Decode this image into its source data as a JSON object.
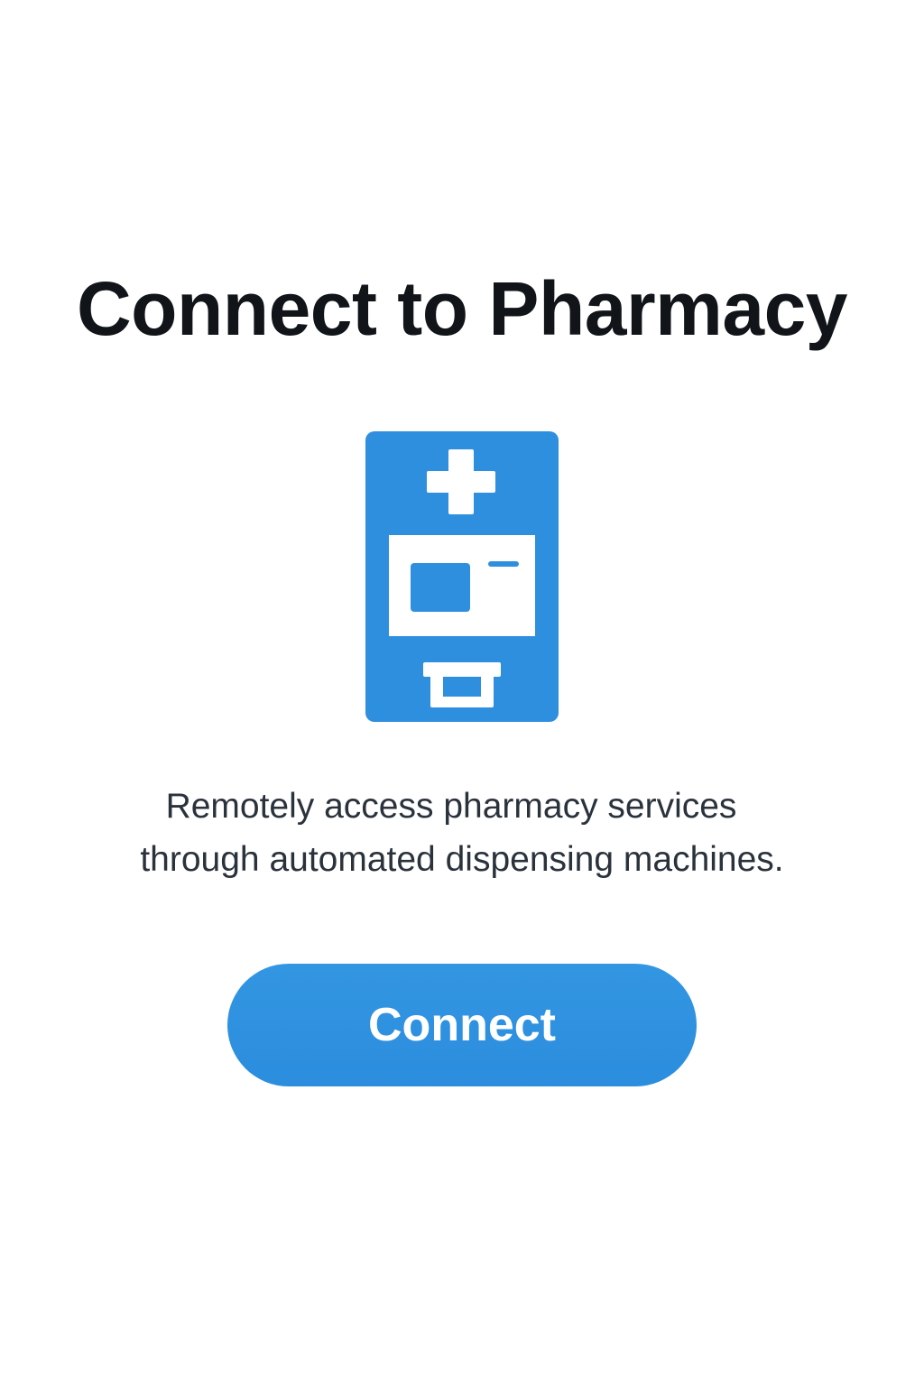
{
  "header": {
    "title": "Connect to Pharmacy"
  },
  "illustration": {
    "icon": "pharmacy-kiosk-icon",
    "color": "#2f8fdf"
  },
  "description": {
    "line_1": "Remotely access pharmacy services",
    "line_2": "through automated dispensing machines."
  },
  "actions": {
    "connect_label": "Connect"
  },
  "colors": {
    "accent": "#2f8fdf",
    "title": "#111418",
    "body_text": "#2a323c",
    "background": "#ffffff"
  }
}
